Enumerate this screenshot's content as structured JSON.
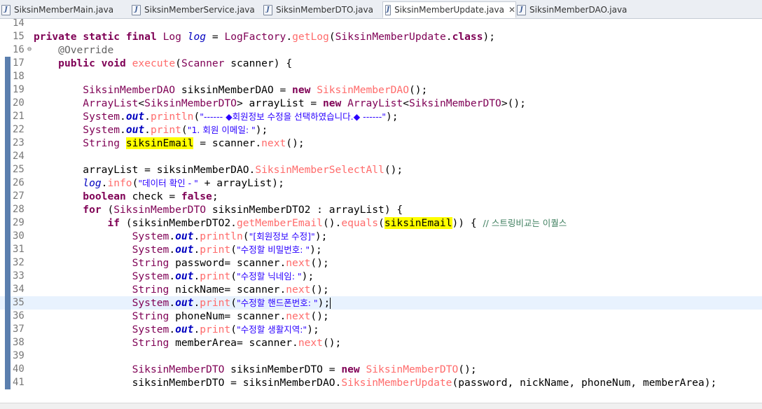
{
  "tabs": [
    {
      "label": "SiksinMemberMain.java",
      "active": false
    },
    {
      "label": "SiksinMemberService.java",
      "active": false
    },
    {
      "label": "SiksinMemberDTO.java",
      "active": false
    },
    {
      "label": "SiksinMemberUpdate.java",
      "active": true,
      "close": "✕"
    },
    {
      "label": "SiksinMemberDAO.java",
      "active": false
    }
  ],
  "lines": [
    {
      "n": "14",
      "code": ""
    },
    {
      "n": "15",
      "code": "private static final Log log = LogFactory.getLog(SiksinMemberUpdate.class);"
    },
    {
      "n": "16",
      "fold": "⊖",
      "code": "    @Override"
    },
    {
      "n": "17",
      "code": "    public void execute(Scanner scanner) {"
    },
    {
      "n": "18",
      "code": ""
    },
    {
      "n": "19",
      "code": "        SiksinMemberDAO siksinMemberDAO = new SiksinMemberDAO();"
    },
    {
      "n": "20",
      "code": "        ArrayList<SiksinMemberDTO> arrayList = new ArrayList<SiksinMemberDTO>();"
    },
    {
      "n": "21",
      "code": "        System.out.println(\"------ ◆회원정보 수정을 선택하였습니다.◆ ------\");"
    },
    {
      "n": "22",
      "code": "        System.out.print(\"1. 회원 이메일: \");"
    },
    {
      "n": "23",
      "code": "        String siksinEmail = scanner.next();"
    },
    {
      "n": "24",
      "code": ""
    },
    {
      "n": "25",
      "code": "        arrayList = siksinMemberDAO.SiksinMemberSelectAll();"
    },
    {
      "n": "26",
      "code": "        log.info(\"데이터 확인 - \" + arrayList);"
    },
    {
      "n": "27",
      "code": "        boolean check = false;"
    },
    {
      "n": "28",
      "code": "        for (SiksinMemberDTO siksinMemberDTO2 : arrayList) {"
    },
    {
      "n": "29",
      "code": "            if (siksinMemberDTO2.getMemberEmail().equals(siksinEmail)) { // 스트링비교는 이퀄스"
    },
    {
      "n": "30",
      "code": "                System.out.println(\"[회원정보 수정]\");"
    },
    {
      "n": "31",
      "code": "                System.out.print(\"수정할 비밀번호: \");"
    },
    {
      "n": "32",
      "code": "                String password= scanner.next();"
    },
    {
      "n": "33",
      "code": "                System.out.print(\"수정할 닉네임: \");"
    },
    {
      "n": "34",
      "code": "                String nickName= scanner.next();"
    },
    {
      "n": "35",
      "code": "                System.out.print(\"수정할 핸드폰번호: \");"
    },
    {
      "n": "36",
      "code": "                String phoneNum= scanner.next();"
    },
    {
      "n": "37",
      "code": "                System.out.print(\"수정할 생활지역:\");"
    },
    {
      "n": "38",
      "code": "                String memberArea= scanner.next();"
    },
    {
      "n": "39",
      "code": ""
    },
    {
      "n": "40",
      "code": "                SiksinMemberDTO siksinMemberDTO = new SiksinMemberDTO();"
    },
    {
      "n": "41",
      "code": "                siksinMemberDTO = siksinMemberDAO.SiksinMemberUpdate(password, nickName, phoneNum, memberArea);"
    }
  ],
  "highlight_word": "siksinEmail",
  "current_line": "35",
  "colors": {
    "keyword": "#7f0055",
    "string": "#2a00ff",
    "field": "#0000c0",
    "method": "#ff6b6b",
    "comment": "#3f7f5f",
    "highlight": "#ffff00"
  }
}
